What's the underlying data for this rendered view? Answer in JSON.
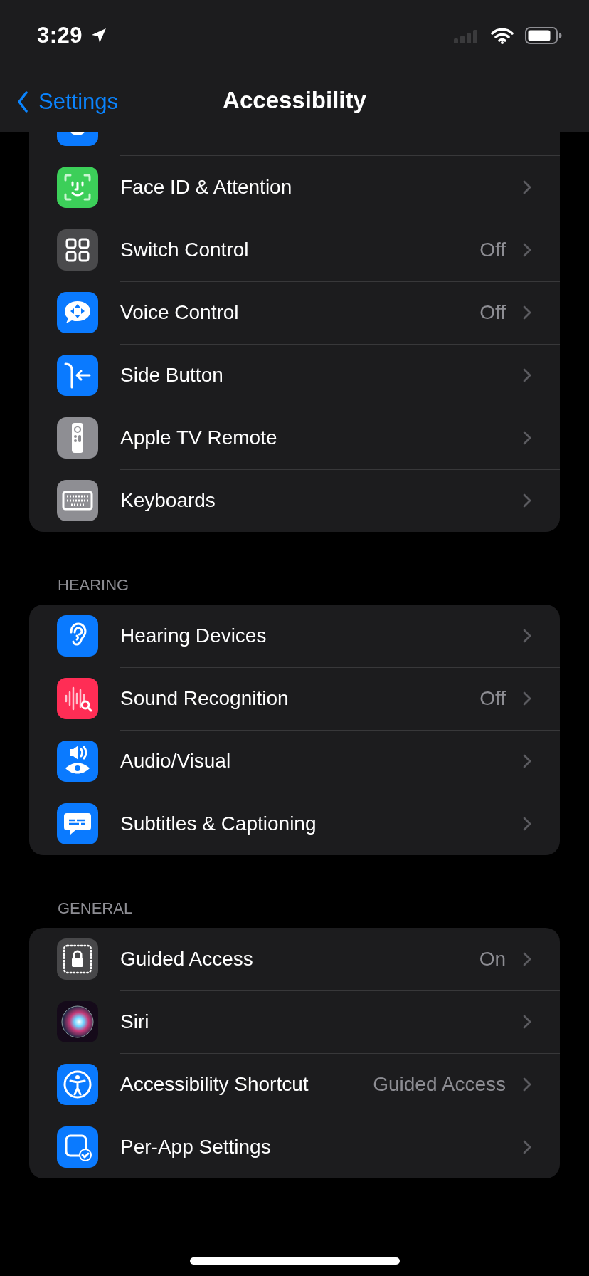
{
  "status_bar": {
    "time": "3:29"
  },
  "nav": {
    "back_label": "Settings",
    "title": "Accessibility"
  },
  "sections": [
    {
      "clipped_top": true,
      "rows": [
        {
          "label": "Face ID & Attention"
        },
        {
          "label": "Switch Control",
          "value": "Off"
        },
        {
          "label": "Voice Control",
          "value": "Off"
        },
        {
          "label": "Side Button"
        },
        {
          "label": "Apple TV Remote"
        },
        {
          "label": "Keyboards"
        }
      ]
    },
    {
      "header": "HEARING",
      "rows": [
        {
          "label": "Hearing Devices"
        },
        {
          "label": "Sound Recognition",
          "value": "Off"
        },
        {
          "label": "Audio/Visual"
        },
        {
          "label": "Subtitles & Captioning"
        }
      ]
    },
    {
      "header": "GENERAL",
      "rows": [
        {
          "label": "Guided Access",
          "value": "On"
        },
        {
          "label": "Siri"
        },
        {
          "label": "Accessibility Shortcut",
          "value": "Guided Access"
        },
        {
          "label": "Per-App Settings"
        }
      ]
    }
  ]
}
